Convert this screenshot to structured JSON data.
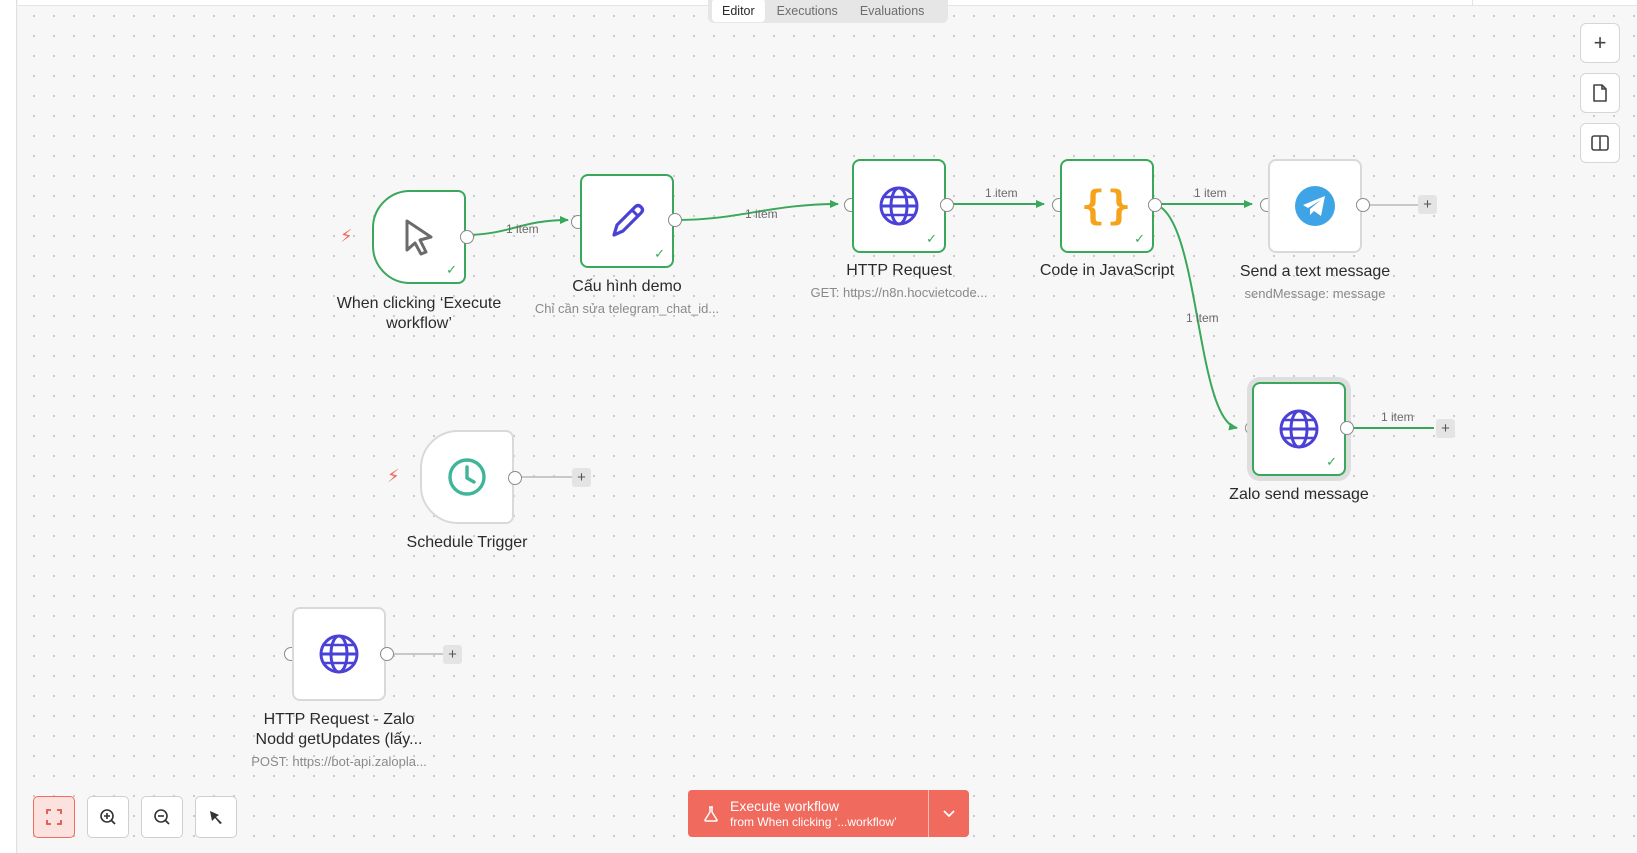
{
  "tabs": [
    {
      "label": "Editor",
      "active": true
    },
    {
      "label": "Executions",
      "active": false
    },
    {
      "label": "Evaluations",
      "active": false
    }
  ],
  "edge_label": "1 item",
  "nodes": {
    "manual_trigger": {
      "title_line1": "When clicking ‘Execute",
      "title_line2": "workflow’",
      "icon": "cursor-icon",
      "status": "success"
    },
    "config_demo": {
      "title": "Cấu hình demo",
      "subtitle": "Chỉ cần sửa telegram_chat_id...",
      "icon": "pencil-icon",
      "status": "success"
    },
    "http_request": {
      "title": "HTTP Request",
      "subtitle": "GET: https://n8n.hocvietcode...",
      "icon": "globe-icon",
      "status": "success"
    },
    "code_js": {
      "title": "Code in JavaScript",
      "icon": "braces-icon",
      "status": "success"
    },
    "telegram": {
      "title": "Send a text message",
      "subtitle": "sendMessage: message",
      "icon": "telegram-icon",
      "status": "idle"
    },
    "zalo_send": {
      "title": "Zalo send message",
      "icon": "globe-icon",
      "status": "success"
    },
    "schedule": {
      "title": "Schedule Trigger",
      "icon": "clock-icon",
      "status": "idle"
    },
    "zalo_updates": {
      "title_line1": "HTTP Request - Zalo",
      "title_line2": "Nodd getUpdates (lấy...",
      "subtitle": "POST: https://bot-api.zalopla...",
      "icon": "globe-icon",
      "status": "idle"
    }
  },
  "right_toolbar": [
    "plus-icon",
    "sticky-note-icon",
    "panel-icon"
  ],
  "bottom_toolbar": [
    "fit-view-icon",
    "zoom-in-icon",
    "zoom-out-icon",
    "tidy-up-icon"
  ],
  "execute": {
    "label": "Execute workflow",
    "sublabel": "from When clicking ‘...workflow’"
  },
  "colors": {
    "accent": "#f06a5e",
    "success": "#3aa85a",
    "globe": "#4a42d6",
    "braces": "#f4a31b",
    "clock": "#3fb59a",
    "telegram": "#3ea4e6"
  }
}
